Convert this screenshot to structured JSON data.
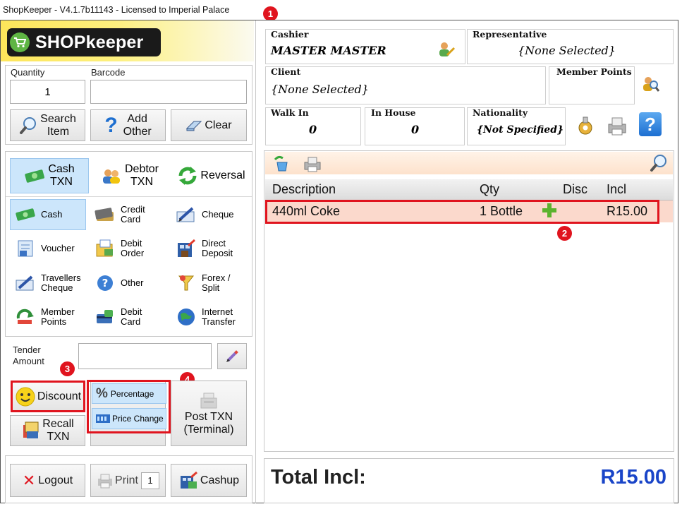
{
  "window": {
    "title": "ShopKeeper - V4.1.7b11143 - Licensed to Imperial Palace"
  },
  "logo": {
    "text": "SHOPkeeper"
  },
  "quantity": {
    "label": "Quantity",
    "value": "1"
  },
  "barcode": {
    "label": "Barcode",
    "value": ""
  },
  "item_buttons": {
    "search_line1": "Search",
    "search_line2": "Item",
    "add_line1": "Add",
    "add_line2": "Other",
    "clear": "Clear"
  },
  "txn_tabs": {
    "cash_line1": "Cash",
    "cash_line2": "TXN",
    "debtor_line1": "Debtor",
    "debtor_line2": "TXN",
    "reversal": "Reversal"
  },
  "payment_methods": [
    {
      "line1": "Cash",
      "line2": "",
      "icon": "cash-icon"
    },
    {
      "line1": "Credit",
      "line2": "Card",
      "icon": "credit-card-icon"
    },
    {
      "line1": "Cheque",
      "line2": "",
      "icon": "cheque-icon"
    },
    {
      "line1": "Voucher",
      "line2": "",
      "icon": "voucher-icon"
    },
    {
      "line1": "Debit",
      "line2": "Order",
      "icon": "debit-order-icon"
    },
    {
      "line1": "Direct",
      "line2": "Deposit",
      "icon": "direct-deposit-icon"
    },
    {
      "line1": "Travellers",
      "line2": "Cheque",
      "icon": "travellers-cheque-icon"
    },
    {
      "line1": "Other",
      "line2": "",
      "icon": "question-icon"
    },
    {
      "line1": "Forex /",
      "line2": "Split",
      "icon": "forex-icon"
    },
    {
      "line1": "Member",
      "line2": "Points",
      "icon": "member-points-icon"
    },
    {
      "line1": "Debit",
      "line2": "Card",
      "icon": "debit-card-icon"
    },
    {
      "line1": "Internet",
      "line2": "Transfer",
      "icon": "globe-icon"
    }
  ],
  "tender": {
    "label_line1": "Tender",
    "label_line2": "Amount",
    "value": ""
  },
  "actions": {
    "discount": "Discount",
    "percentage": "Percentage",
    "price_change": "Price Change",
    "recall_line1": "Recall",
    "recall_line2": "TXN",
    "post_line1": "Post TXN",
    "post_line2": "(Terminal)"
  },
  "footer_buttons": {
    "logout": "Logout",
    "print": "Print",
    "print_copies": "1",
    "cashup": "Cashup"
  },
  "cashier": {
    "label": "Cashier",
    "value": "MASTER MASTER"
  },
  "representative": {
    "label": "Representative",
    "value": "{None Selected}"
  },
  "client": {
    "label": "Client",
    "value": "{None Selected}"
  },
  "member_points": {
    "label": "Member Points",
    "value": ""
  },
  "walk_in": {
    "label": "Walk In",
    "value": "0"
  },
  "in_house": {
    "label": "In House",
    "value": "0"
  },
  "nationality": {
    "label": "Nationality",
    "value": "{Not Specified}"
  },
  "grid": {
    "columns": [
      "Description",
      "Qty",
      "Disc",
      "Incl"
    ],
    "rows": [
      {
        "description": "440ml Coke",
        "qty": "1 Bottle",
        "disc": "",
        "incl": "R15.00"
      }
    ]
  },
  "total": {
    "label": "Total Incl:",
    "value": "R15.00"
  },
  "callouts": [
    "1",
    "2",
    "3",
    "4"
  ],
  "colors": {
    "highlight_red": "#e0141e",
    "total_blue": "#1a45c8",
    "selected_row": "#fbd9cc",
    "selected_tab": "#cce6fb"
  }
}
